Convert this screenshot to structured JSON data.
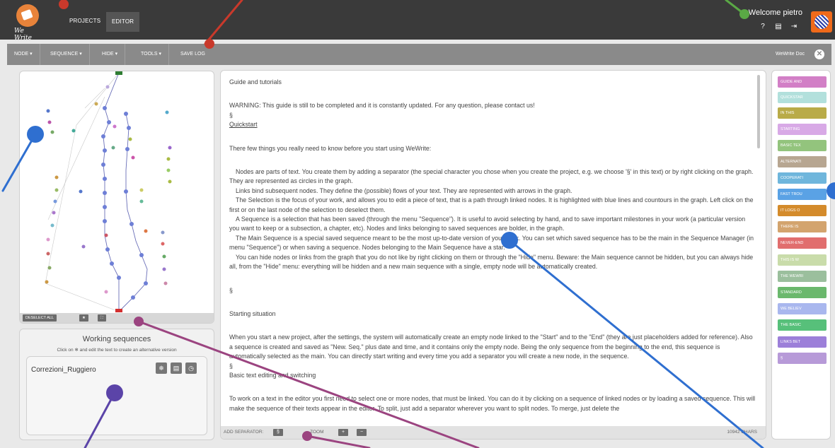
{
  "topbar": {
    "logo_text": "We Write",
    "nav": [
      "PROJECTS",
      "EDITOR"
    ],
    "welcome": "Welcome pietro"
  },
  "toolbar": {
    "items": [
      "NODE ▾",
      "SEQUENCE ▾",
      "HIDE ▾",
      "TOOLS ▾",
      "SAVE LOG"
    ],
    "doc_label": "WeWrite Doc",
    "close_label": "✕"
  },
  "graph": {
    "footer_buttons": [
      "DESELECT ALL",
      "★",
      "⛶"
    ]
  },
  "working_sequences": {
    "title": "Working sequences",
    "subtitle": "Click on ❄ and edit the text to create an alternative version",
    "items": [
      {
        "name": "Correzioni_Ruggiero"
      }
    ]
  },
  "editor": {
    "paragraphs": [
      "Guide and tutorials",
      "",
      "WARNING: This guide is still to be completed and it is constantly updated. For any question, please contact us!",
      "§",
      "Quickstart",
      "",
      "There few things you really need to know before  you start using WeWrite:",
      "",
      "Nodes are parts of text. You create them by adding a separator (the special character you chose when you create the project, e.g. we choose '§' in this text) or by right clicking on the graph. They are represented as circles in the graph.",
      "Links bind subsequent nodes. They define the (possible) flows of your text. They are represented with arrows in the graph.",
      "The Selection is the focus of your work, and allows you to edit a piece of text, that is a path through linked nodes. It is highlighted with blue lines and countours in the graph. Left click on the first or on the last node of the selection to deselect them.",
      "A Sequence is a selection that has been saved (through the menu \"Sequence\"). It is useful to avoid selecting by hand, and to save important milestones in your work (a particular version you want to keep or a subsection, a chapter, etc). Nodes and links belonging to saved sequences are bolder, in the graph.",
      "The Main Sequence is a special saved sequence meant to be the most up-to-date version of your work. You can set which saved sequence has to be the main in the Sequence Manager (in menu \"Sequence\") or when saving a sequence. Nodes belonging to the Main Sequence have a star.",
      "You can hide nodes or links from the graph  that you do not like by right clicking on them or through the \"Hide\" menu. Beware: the Main sequence cannot be hidden, but you can always hide all, from the \"Hide\" menu: everything will be hidden and a new main sequence with a single, empty node will be automatically created.",
      "",
      "§",
      "",
      "Starting situation",
      "",
      "When you start a new project, after the settings, the system will automatically create an empty node linked to the \"Start\" and to the \"End\" (they are just placeholders added for reference). Also a sequence is created and saved as \"New. Seq.\" plus date and time, and it contains only the empty node. Being the only sequence from the beginning to the end, this sequence is automatically selected as the main. You can directly start writing and every time you add a separator you will create a new node, in the sequence.",
      "§",
      "Basic text editing and switching",
      "",
      "To work on a text in the editor you first need to select one or more nodes, that must be linked. You can do it by clicking on a sequence of linked nodes or by loading a saved sequence. This will make the sequence of their texts appear in the editor. To split, just add a separator wherever you want to split nodes. To merge, just delete the"
    ],
    "footer": {
      "add_separator_label": "ADD SEPARATOR:",
      "separator_button": "§",
      "zoom_label": "ZOOM",
      "zoom_in": "+",
      "zoom_out": "−",
      "chars": "10942 CHARS"
    }
  },
  "sidebar": {
    "items": [
      {
        "label": "GUIDE AND",
        "color": "#d27fc6"
      },
      {
        "label": "QUICKSTAR",
        "color": "#b2e0dc"
      },
      {
        "label": "IN THIS",
        "color": "#b9ab48"
      },
      {
        "label": "STARTING",
        "color": "#d8a9e6"
      },
      {
        "label": "BASIC TEX",
        "color": "#93c47d"
      },
      {
        "label": "ALTERNATI",
        "color": "#b7a691"
      },
      {
        "label": "COOPERATI",
        "color": "#6fb6dc"
      },
      {
        "label": "FAST TROU",
        "color": "#5aa2e5"
      },
      {
        "label": "IT LOGS O",
        "color": "#d48b2b"
      },
      {
        "label": "THERE IS",
        "color": "#d3a46e"
      },
      {
        "label": "NEVER-END",
        "color": "#e16e6e"
      },
      {
        "label": "THIS IS W",
        "color": "#c9dcaa"
      },
      {
        "label": "THE WEWRI",
        "color": "#9bbf9d"
      },
      {
        "label": "STANDARD",
        "color": "#6bb86d"
      },
      {
        "label": "WE BELIEV",
        "color": "#a9b7ee"
      },
      {
        "label": "THE BASIC",
        "color": "#57c07a"
      },
      {
        "label": "LINKS BET",
        "color": "#9c7fd9"
      },
      {
        "label": "§",
        "color": "#b79ad8"
      }
    ]
  },
  "colors": {
    "topbar": "#3a3a3a",
    "toolbar": "#8a8a8a",
    "annotation_red": "#c9392b",
    "annotation_green": "#5aa845",
    "annotation_blue": "#2f6fd0",
    "annotation_purple": "#5b44a8",
    "annotation_magenta": "#9b4480"
  }
}
